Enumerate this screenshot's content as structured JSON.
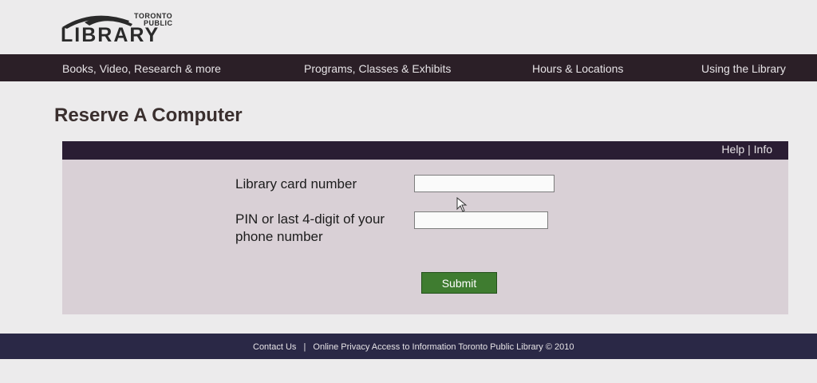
{
  "logo": {
    "line1": "TORONTO",
    "line2": "PUBLIC",
    "line3": "LIBRARY"
  },
  "nav": [
    {
      "label": "Books, Video, Research & more"
    },
    {
      "label": "Programs, Classes & Exhibits"
    },
    {
      "label": "Hours & Locations"
    },
    {
      "label": "Using the Library"
    }
  ],
  "page": {
    "title": "Reserve A Computer"
  },
  "panel": {
    "help": "Help",
    "separator": "|",
    "info": "Info"
  },
  "form": {
    "card_label": "Library card number",
    "card_value": "",
    "pin_label": "PIN or last 4-digit of your phone number",
    "pin_value": "",
    "submit_label": "Submit"
  },
  "footer": {
    "contact": "Contact Us",
    "separator": "|",
    "text": "Online Privacy Access to Information Toronto Public Library © 2010"
  },
  "colors": {
    "navbar": "#2b1f27",
    "panel_bar": "#2a1d33",
    "panel_bg": "#d9d0d6",
    "submit_bg": "#3f7c30",
    "footer": "#2a2846"
  }
}
